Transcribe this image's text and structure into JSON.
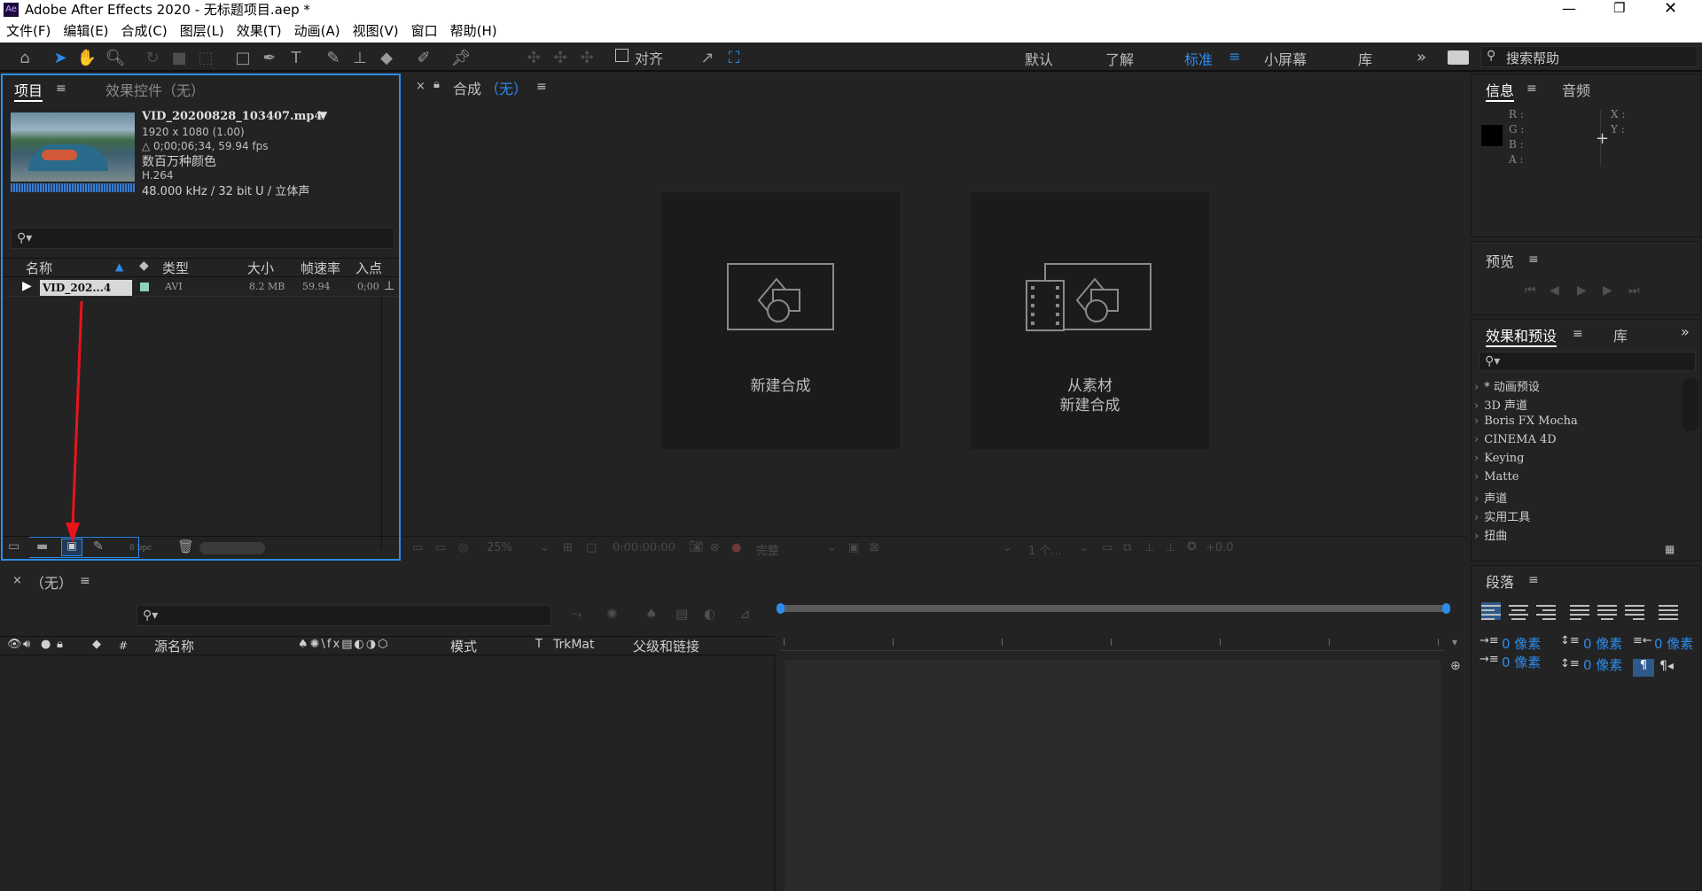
{
  "window": {
    "title": "Adobe After Effects 2020 - 无标题项目.aep *",
    "app_badge": "Ae"
  },
  "menu": [
    "文件(F)",
    "编辑(E)",
    "合成(C)",
    "图层(L)",
    "效果(T)",
    "动画(A)",
    "视图(V)",
    "窗口",
    "帮助(H)"
  ],
  "toolbar": {
    "align_label": "对齐"
  },
  "workspaces": [
    "默认",
    "了解",
    "标准",
    "小屏幕",
    "库"
  ],
  "active_workspace": "标准",
  "help_search": {
    "placeholder": "搜索帮助"
  },
  "project_panel": {
    "tab_project": "项目",
    "tab_effects": "效果控件（无）",
    "asset": {
      "filename": "VID_20200828_103407.mp4",
      "resolution": "1920 x 1080 (1.00)",
      "duration": "△ 0;00;06;34, 59.94 fps",
      "colors": "数百万种颜色",
      "codec": "H.264",
      "audio": "48.000 kHz / 32 bit U / 立体声"
    },
    "columns": [
      "名称",
      "类型",
      "大小",
      "帧速率",
      "入点"
    ],
    "rows": [
      {
        "name": "VID_202...4",
        "type": "AVI",
        "size": "8.2 MB",
        "fps": "59.94",
        "in": "0;00"
      }
    ],
    "bpc": "8 bpc"
  },
  "composition_panel": {
    "title": "合成",
    "title_value": "（无）",
    "new_comp": "新建合成",
    "from_footage_line1": "从素材",
    "from_footage_line2": "新建合成",
    "zoom": "25%",
    "timecode": "0:00:00:00",
    "quality": "完整",
    "views": "1 个...",
    "exposure": "+0.0"
  },
  "info_panel": {
    "tab_info": "信息",
    "tab_audio": "音频",
    "r": "R :",
    "g": "G :",
    "b": "B :",
    "a": "A :",
    "x": "X :",
    "y": "Y :"
  },
  "preview_panel": {
    "title": "预览"
  },
  "effects_panel": {
    "title": "效果和预设",
    "tab_library": "库",
    "items": [
      "* 动画预设",
      "3D 声道",
      "Boris FX Mocha",
      "CINEMA 4D",
      "Keying",
      "Matte",
      "声道",
      "实用工具",
      "扭曲"
    ]
  },
  "timeline_panel": {
    "title": "（无）",
    "columns": [
      "#",
      "源名称",
      "模式",
      "T",
      "TrkMat",
      "父级和链接"
    ]
  },
  "paragraph_panel": {
    "title": "段落",
    "indent_left": "0 像素",
    "space_before": "0 像素",
    "indent_right": "0 像素",
    "first_line": "0 像素",
    "space_after": "0 像素"
  },
  "colors": {
    "accent": "#2d8ceb",
    "annotation_arrow": "#e8141b"
  }
}
